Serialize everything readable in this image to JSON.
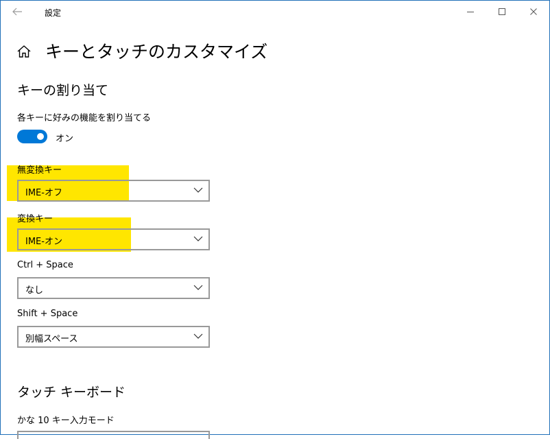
{
  "window": {
    "title": "設定"
  },
  "page": {
    "title": "キーとタッチのカスタマイズ"
  },
  "key_assign": {
    "header": "キーの割り当て",
    "toggle_label": "各キーに好みの機能を割り当てる",
    "toggle_state": "オン",
    "toggle_on": true,
    "muhenkan": {
      "label": "無変換キー",
      "value": "IME-オフ"
    },
    "henkan": {
      "label": "変換キー",
      "value": "IME-オン"
    },
    "ctrl_space": {
      "label": "Ctrl + Space",
      "value": "なし"
    },
    "shift_space": {
      "label": "Shift + Space",
      "value": "別幅スペース"
    }
  },
  "touch_keyboard": {
    "header": "タッチ キーボード",
    "kana_label": "かな 10 キー入力モード"
  },
  "colors": {
    "accent": "#0078d7",
    "highlight": "#ffe600",
    "border": "#999999"
  },
  "icons": {
    "back": "back-arrow-icon",
    "home": "home-icon",
    "dropdown": "chevron-down-icon"
  }
}
